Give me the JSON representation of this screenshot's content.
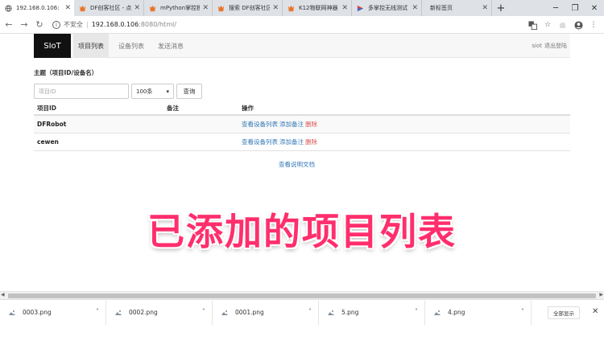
{
  "browser": {
    "tabs": [
      {
        "title": "192.168.0.106:",
        "active": true,
        "favicon": "globe-icon"
      },
      {
        "title": "DF创客社区 - 点",
        "favicon": "df-logo-icon"
      },
      {
        "title": "mPython掌控板",
        "favicon": "df-logo-icon"
      },
      {
        "title": "搜索 DF创客社区",
        "favicon": "df-logo-icon"
      },
      {
        "title": "K12物联网神器",
        "favicon": "df-logo-icon"
      },
      {
        "title": "多掌控无线测试",
        "favicon": "colorful-logo-icon"
      },
      {
        "title": "新标签页",
        "favicon": ""
      }
    ],
    "new_tab_label": "+",
    "address": {
      "security": "不安全",
      "separator": "|",
      "host": "192.168.0.106",
      "path": ":8080/html/"
    }
  },
  "site": {
    "brand": "SIoT",
    "nav": [
      {
        "label": "项目列表",
        "active": true
      },
      {
        "label": "设备列表",
        "active": false
      },
      {
        "label": "发送消息",
        "active": false
      }
    ],
    "user": "siot",
    "logout": "退出登陆",
    "subtitle": "主题（项目ID/设备名）",
    "search_placeholder": "项目ID",
    "page_size": "100条",
    "query_button": "查询",
    "table": {
      "headers": [
        "项目ID",
        "备注",
        "操作"
      ],
      "rows": [
        {
          "name": "DFRobot",
          "note": "",
          "actions": [
            "查看设备列表",
            "添加备注",
            "删除"
          ]
        },
        {
          "name": "cewen",
          "note": "",
          "actions": [
            "查看设备列表",
            "添加备注",
            "删除"
          ]
        }
      ]
    },
    "docs_link": "查看说明文档"
  },
  "caption": "已添加的项目列表",
  "downloads": {
    "items": [
      "0003.png",
      "0002.png",
      "0001.png",
      "5.png",
      "4.png"
    ],
    "show_all": "全部显示",
    "close": "✕"
  },
  "colors": {
    "caption": "#ff2e6c",
    "link": "#337ab7",
    "delete": "#d9534f",
    "brand_bg": "#111111"
  }
}
